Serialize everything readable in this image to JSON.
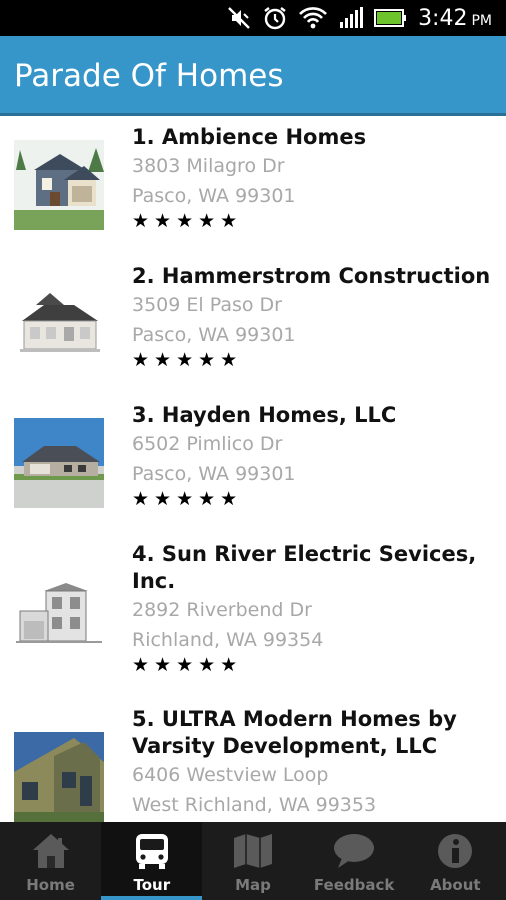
{
  "status_bar": {
    "time": "3:42",
    "ampm": "PM",
    "icons": [
      "mute-icon",
      "alarm-icon",
      "wifi-icon",
      "signal-icon",
      "battery-icon"
    ]
  },
  "app_bar": {
    "title": "Parade Of Homes"
  },
  "homes": [
    {
      "name": "1. Ambience Homes",
      "address": "3803 Milagro Dr",
      "city": "Pasco, WA 99301",
      "stars": "★★★★★"
    },
    {
      "name": "2. Hammerstrom Construction",
      "address": "3509 El Paso Dr",
      "city": "Pasco, WA 99301",
      "stars": "★★★★★"
    },
    {
      "name": "3. Hayden Homes, LLC",
      "address": "6502 Pimlico Dr",
      "city": "Pasco, WA 99301",
      "stars": "★★★★★"
    },
    {
      "name": "4. Sun River Electric Sevices, Inc.",
      "address": "2892 Riverbend Dr",
      "city": "Richland, WA 99354",
      "stars": "★★★★★"
    },
    {
      "name": "5. ULTRA Modern Homes by Varsity Development, LLC",
      "address": "6406 Westview Loop",
      "city": "West Richland, WA 99353",
      "stars": ""
    }
  ],
  "tabs": [
    {
      "label": "Home",
      "icon": "house-icon"
    },
    {
      "label": "Tour",
      "icon": "bus-icon"
    },
    {
      "label": "Map",
      "icon": "map-icon"
    },
    {
      "label": "Feedback",
      "icon": "speech-bubble-icon"
    },
    {
      "label": "About",
      "icon": "info-icon"
    }
  ],
  "active_tab": "Tour",
  "colors": {
    "accent": "#3796c9",
    "tabbar": "#1c1c1c",
    "battery": "#6cc32c"
  }
}
